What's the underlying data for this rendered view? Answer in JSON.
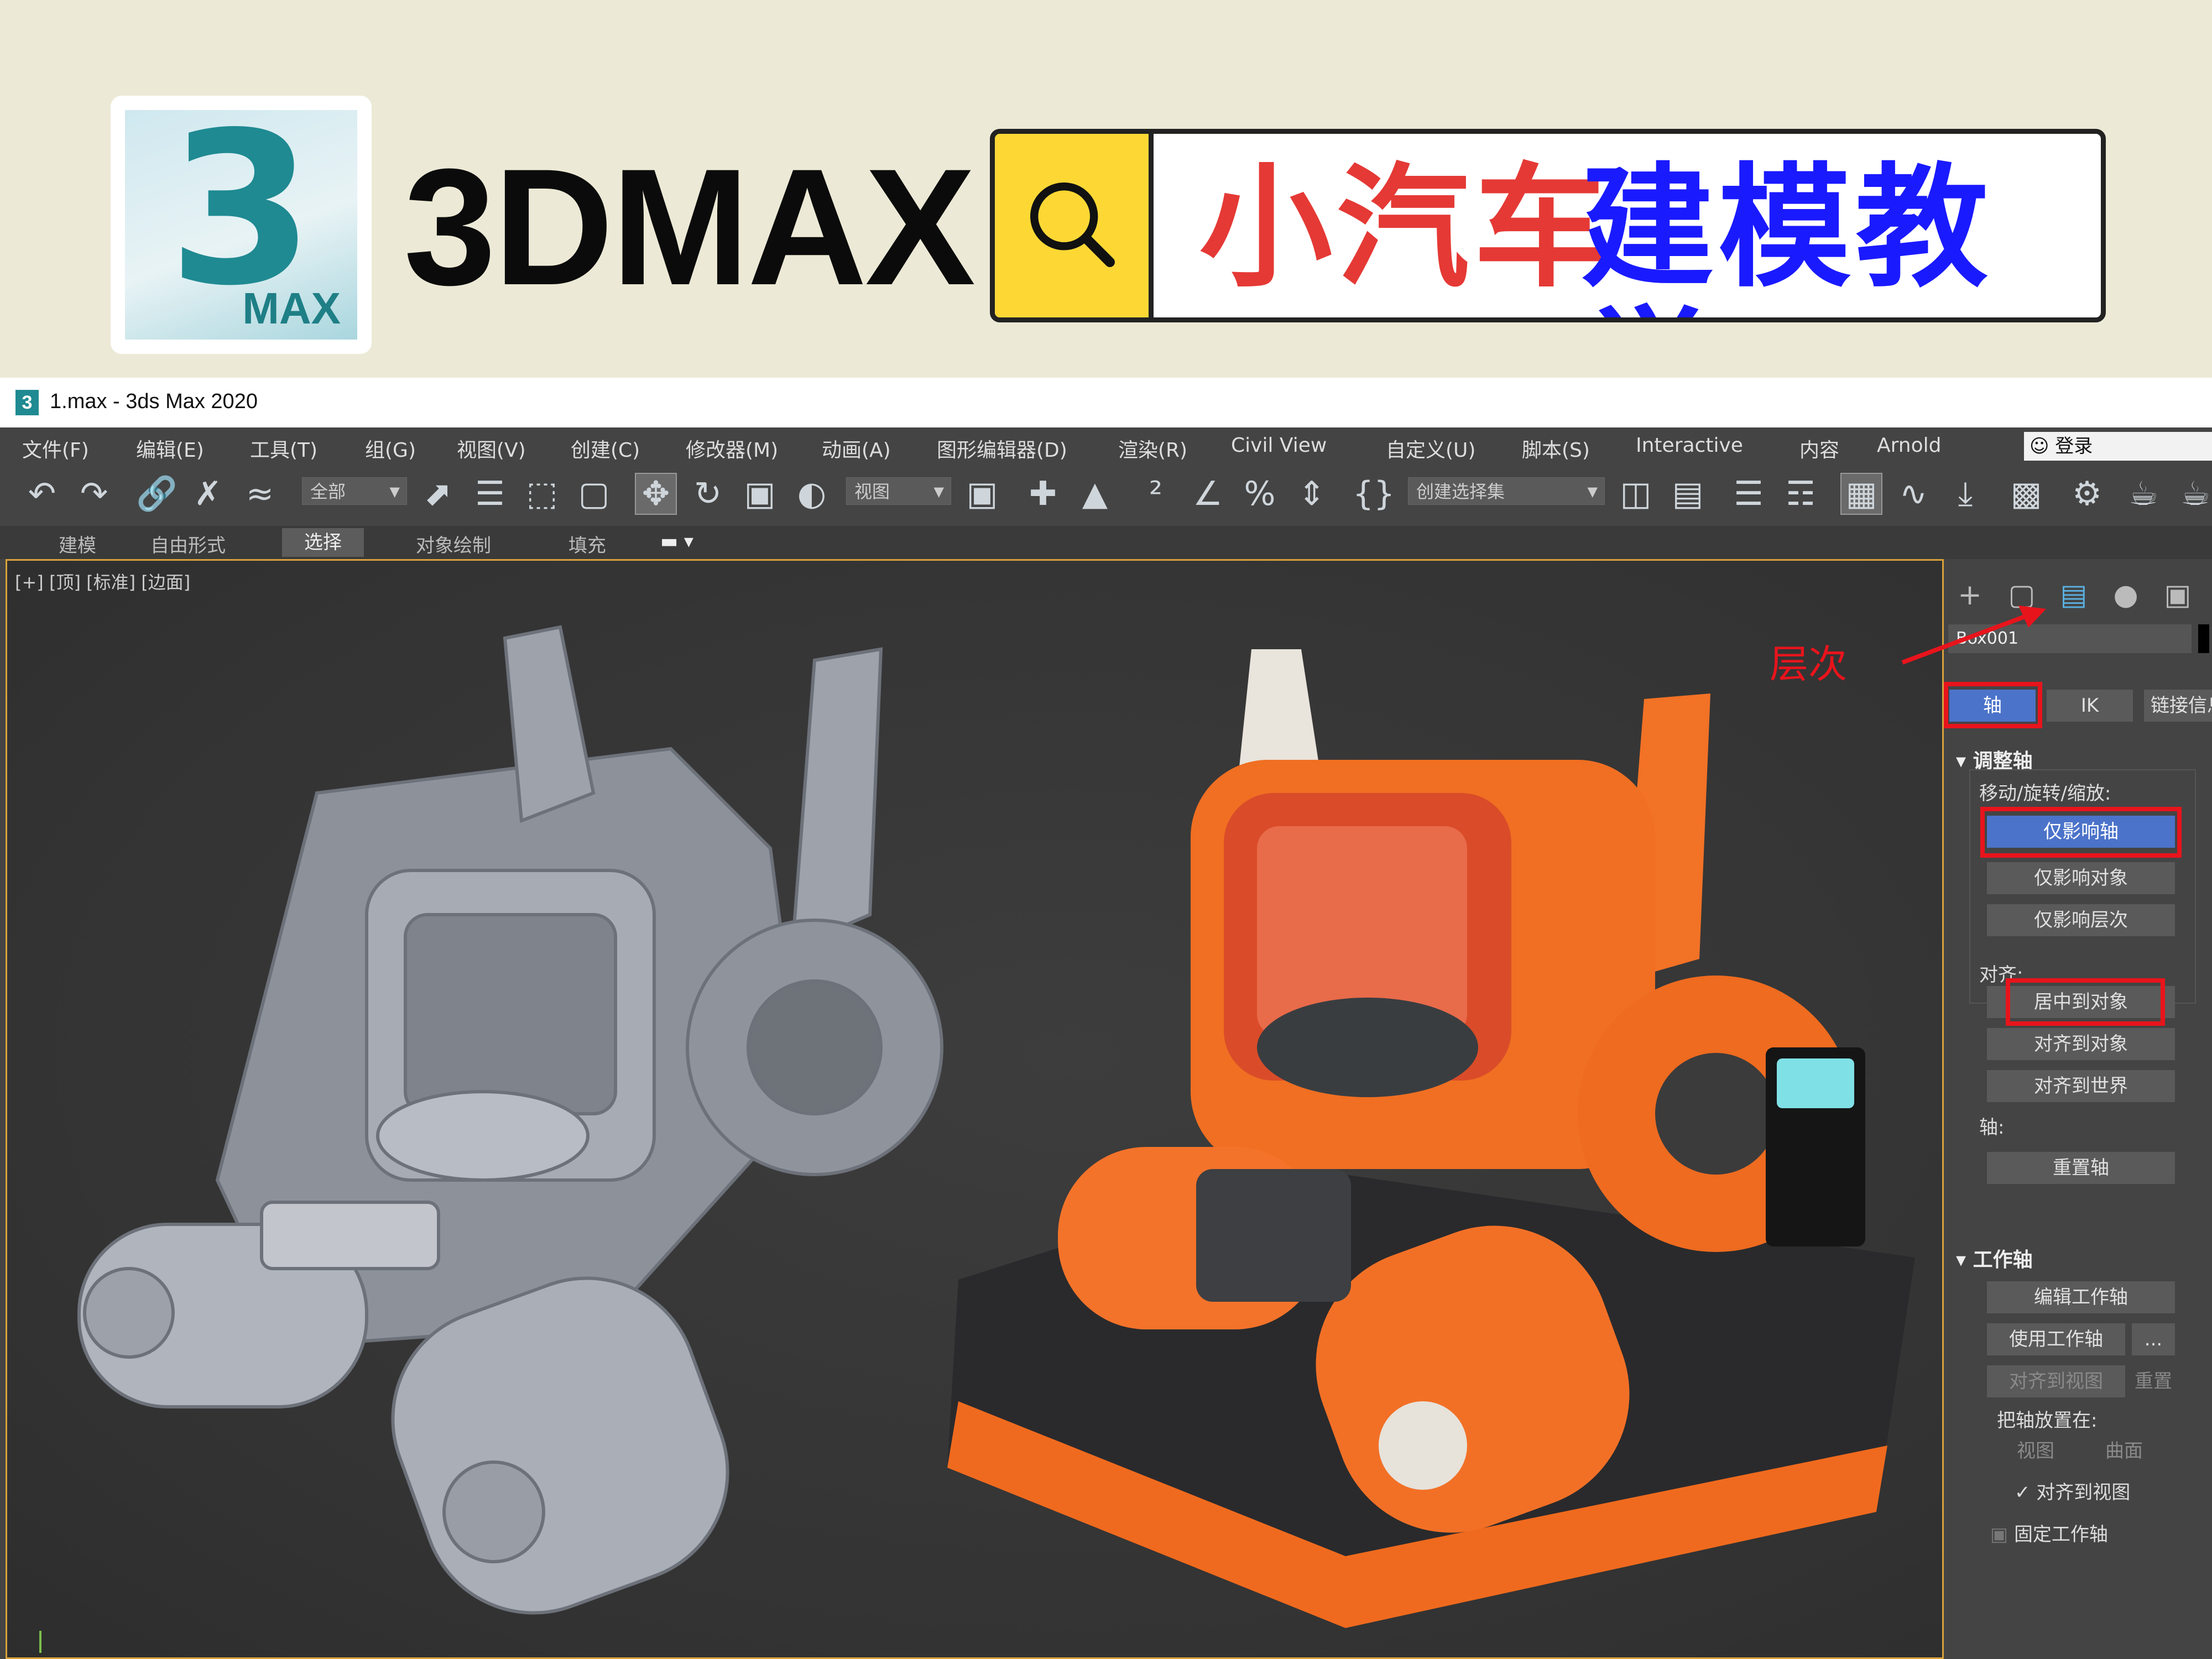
{
  "banner": {
    "logo_digit": "3",
    "logo_text": "MAX",
    "brand": "3DMAX",
    "title_red": "小汽车",
    "title_blue": "建模教学"
  },
  "window": {
    "title": "1.max - 3ds Max 2020",
    "app_icon": "3"
  },
  "menubar": {
    "items": [
      "文件(F)",
      "编辑(E)",
      "工具(T)",
      "组(G)",
      "视图(V)",
      "创建(C)",
      "修改器(M)",
      "动画(A)",
      "图形编辑器(D)",
      "渲染(R)",
      "Civil View",
      "自定义(U)",
      "脚本(S)",
      "Interactive",
      "内容",
      "Arnold"
    ],
    "login": "登录"
  },
  "toolbar": {
    "filter": "全部",
    "coord": "视图",
    "selection_set": "创建选择集",
    "icons": [
      "undo-icon",
      "redo-icon",
      "link-icon",
      "unlink-icon",
      "bind-space-warp-icon",
      "select-object-icon",
      "select-by-name-icon",
      "rect-selection-icon",
      "window-crossing-icon",
      "move-icon",
      "rotate-icon",
      "scale-icon",
      "place-icon",
      "pivot-center-icon",
      "snap-3d-icon",
      "angle-snap-icon",
      "percent-snap-icon",
      "spinner-snap-icon",
      "named-selection-icon",
      "mirror-icon",
      "align-icon",
      "scene-explorer-icon",
      "layer-explorer-icon",
      "ribbon-icon",
      "curve-editor-icon",
      "schematic-view-icon",
      "material-editor-icon",
      "render-setup-icon",
      "render-frame-icon",
      "render-icon"
    ]
  },
  "ribbon": {
    "tabs": [
      "建模",
      "自由形式",
      "选择",
      "对象绘制",
      "填充"
    ],
    "active": "选择"
  },
  "viewport": {
    "label": "[+] [顶] [标准] [边面]"
  },
  "command_panel": {
    "object_name": "Box001",
    "tabs": [
      "轴",
      "IK",
      "链接信息"
    ],
    "adjust_pivot": {
      "title": "调整轴",
      "move_label": "移动/旋转/缩放:",
      "buttons": [
        "仅影响轴",
        "仅影响对象",
        "仅影响层次"
      ],
      "align_label": "对齐:",
      "align_buttons": [
        "居中到对象",
        "对齐到对象",
        "对齐到世界"
      ],
      "pivot_label": "轴:",
      "reset": "重置轴"
    },
    "working_pivot": {
      "title": "工作轴",
      "edit": "编辑工作轴",
      "use": "使用工作轴",
      "more": "...",
      "align_view": "对齐到视图",
      "reset": "重置",
      "place_label": "把轴放置在:",
      "view": "视图",
      "surface": "曲面",
      "align_to_view_check": "对齐到视图",
      "lock": "固定工作轴"
    }
  },
  "annotation": "层次",
  "colors": {
    "accent_blue": "#4b73c9",
    "annotation_red": "#e8141c",
    "banner_bg": "#ECE9D6",
    "car_orange": "#f26b1d"
  }
}
